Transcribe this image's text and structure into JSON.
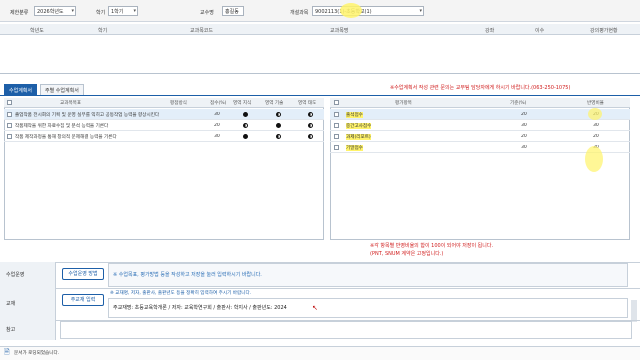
{
  "filters": {
    "category_label": "제한분류",
    "category_value": "2026학년도",
    "term_label": "학기",
    "term_value": "1학기",
    "dept_label": "교수명",
    "dept_value": "홍길동",
    "course_label": "개설과목",
    "course_value": "9002113(1)-초등학교(1)"
  },
  "top_grid": {
    "headers": [
      "학년도",
      "학기",
      "교과목코드",
      "교과목명",
      "강좌",
      "이수",
      "강의평가현황"
    ]
  },
  "tabs": [
    "수업계획서",
    "주별 수업계획서"
  ],
  "notice": "※수업계획서 작성 관련 문의는 교무팀 담당자에게 하시기 바랍니다.(063-250-1075)",
  "left_table": {
    "headers": [
      "교과목목표",
      "평점방식",
      "점수(%)",
      "영역 지식",
      "영역 기술",
      "영역 태도"
    ],
    "rows": [
      {
        "text": "졸업작품 전시회의 기획 및 운영 실무를 익히고 공동작업 능력을 향상시킨다",
        "pct": "30",
        "d1": "full",
        "d2": "half",
        "d3": "half"
      },
      {
        "text": "작품제작을 위한 자료수집 및 분석 능력을 기른다",
        "pct": "20",
        "d1": "half",
        "d2": "full",
        "d3": "half"
      },
      {
        "text": "작품 제작과정을 통해 창의적 문제해결 능력을 기른다",
        "pct": "30",
        "d1": "full",
        "d2": "half",
        "d3": "half"
      }
    ]
  },
  "right_table": {
    "headers": [
      "평가항목",
      "기준(%)",
      "반영비율"
    ],
    "rows": [
      {
        "name": "출석점수",
        "base": "20",
        "ratio": "20"
      },
      {
        "name": "중간고사점수",
        "base": "30",
        "ratio": "30"
      },
      {
        "name": "과제(리포트)",
        "base": "20",
        "ratio": "20"
      },
      {
        "name": "기말점수",
        "base": "30",
        "ratio": "30"
      }
    ],
    "warning": "※각 항목별 반영비율의 합이 100이 되어야 저장이 됩니다.",
    "warning2": "(PNT, SNUM 계약은 고정입니다.)"
  },
  "form": {
    "row1_label": "수업운영",
    "row1_button": "수업운영 방법",
    "row1_text": "※ 수업목표, 평가방법 등을 작성하고 저장을 눌러 입력하시기 바랍니다.",
    "row2_label": "교재",
    "row2_button": "주교재 입력",
    "row2_hint": "※ 교재명, 저자, 출판사, 출판년도 등을 정확히 입력하여 주시기 바랍니다.",
    "row2_text": "주교재명: 초등교육학개론 / 저자: 교육학연구회 / 출판사: 학지사 / 출판년도: 2024",
    "row3_label": "참고"
  },
  "status": "문서가 로딩되었습니다."
}
